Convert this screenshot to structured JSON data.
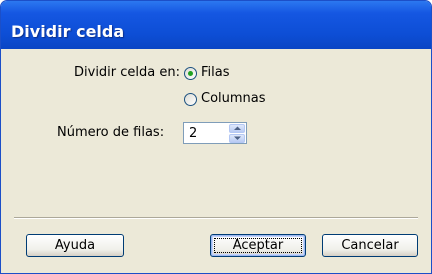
{
  "dialog": {
    "title": "Dividir celda",
    "split_label": "Dividir celda en:",
    "options": [
      {
        "label": "Filas",
        "selected": true
      },
      {
        "label": "Columnas",
        "selected": false
      }
    ],
    "rows_label": "Número de filas:",
    "rows_value": "2",
    "buttons": {
      "help": "Ayuda",
      "ok": "Aceptar",
      "cancel": "Cancelar"
    }
  }
}
